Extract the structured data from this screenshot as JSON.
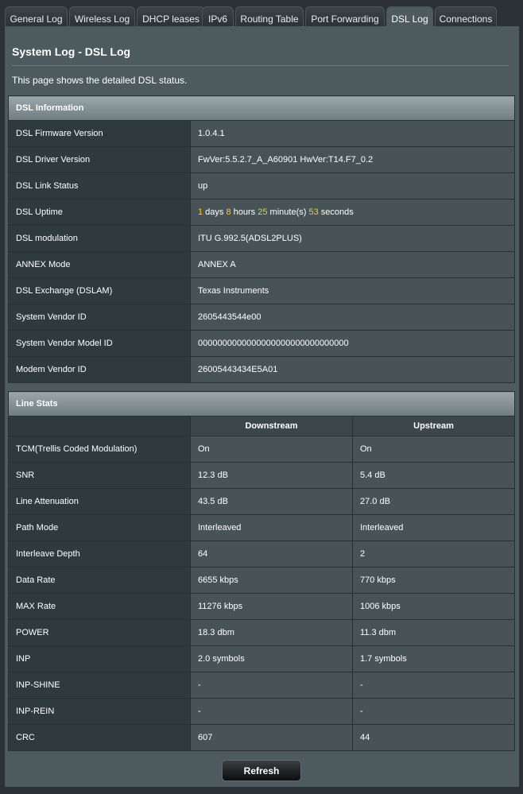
{
  "tabs": [
    {
      "label": "General Log"
    },
    {
      "label": "Wireless Log"
    },
    {
      "label": "DHCP leases"
    },
    {
      "label": "IPv6"
    },
    {
      "label": "Routing Table"
    },
    {
      "label": "Port Forwarding"
    },
    {
      "label": "DSL Log",
      "active": true
    },
    {
      "label": "Connections"
    }
  ],
  "page": {
    "title": "System Log - DSL Log",
    "description": "This page shows the detailed DSL status."
  },
  "dsl_info": {
    "header": "DSL Information",
    "rows": [
      {
        "label": "DSL Firmware Version",
        "value": "1.0.4.1"
      },
      {
        "label": "DSL Driver Version",
        "value": "FwVer:5.5.2.7_A_A60901 HwVer:T14.F7_0.2"
      },
      {
        "label": "DSL Link Status",
        "value": "up"
      },
      {
        "label": "DSL Uptime",
        "value": ""
      },
      {
        "label": "DSL modulation",
        "value": "ITU G.992.5(ADSL2PLUS)"
      },
      {
        "label": "ANNEX Mode",
        "value": "ANNEX A"
      },
      {
        "label": "DSL Exchange (DSLAM)",
        "value": "Texas Instruments"
      },
      {
        "label": "System Vendor ID",
        "value": "2605443544e00"
      },
      {
        "label": "System Vendor Model ID",
        "value": "0000000000000000000000000000000"
      },
      {
        "label": "Modem Vendor ID",
        "value": "26005443434E5A01"
      }
    ],
    "uptime": {
      "days": "1",
      "days_unit": " days ",
      "hours": "8",
      "hours_unit": " hours ",
      "minutes": "25",
      "minutes_unit": " minute(s) ",
      "seconds": "53",
      "seconds_unit": " seconds"
    }
  },
  "line_stats": {
    "header": "Line Stats",
    "columns": {
      "downstream": "Downstream",
      "upstream": "Upstream"
    },
    "rows": [
      {
        "label": "TCM(Trellis Coded Modulation)",
        "down": "On",
        "up": "On"
      },
      {
        "label": "SNR",
        "down": "12.3 dB",
        "up": "5.4 dB"
      },
      {
        "label": "Line Attenuation",
        "down": "43.5 dB",
        "up": "27.0 dB"
      },
      {
        "label": "Path Mode",
        "down": "Interleaved",
        "up": "Interleaved"
      },
      {
        "label": "Interleave Depth",
        "down": "64",
        "up": "2"
      },
      {
        "label": "Data Rate",
        "down": "6655 kbps",
        "up": "770 kbps"
      },
      {
        "label": "MAX Rate",
        "down": "11276 kbps",
        "up": "1006 kbps"
      },
      {
        "label": "POWER",
        "down": "18.3 dbm",
        "up": "11.3 dbm"
      },
      {
        "label": "INP",
        "down": "2.0 symbols",
        "up": "1.7 symbols"
      },
      {
        "label": "INP-SHINE",
        "down": "-",
        "up": "-"
      },
      {
        "label": "INP-REIN",
        "down": "-",
        "up": "-"
      },
      {
        "label": "CRC",
        "down": "607",
        "up": "44"
      }
    ]
  },
  "refresh_label": "Refresh",
  "colors": {
    "highlight": "#ffcc00",
    "panel": "#4d5a5e",
    "background": "#2b3134"
  }
}
